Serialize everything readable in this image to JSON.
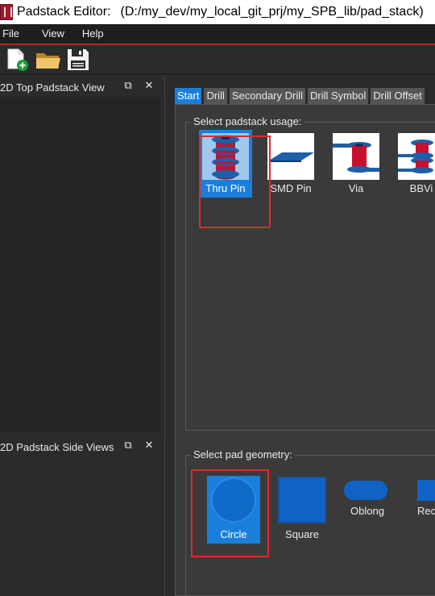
{
  "window": {
    "app_title": "Padstack Editor:",
    "file_path": "(D:/my_dev/my_local_git_prj/my_SPB_lib/pad_stack)"
  },
  "menu": {
    "items": [
      "File",
      "View",
      "Help"
    ]
  },
  "toolbar": {
    "new_icon": "new-file-icon",
    "open_icon": "open-folder-icon",
    "save_icon": "save-disk-icon"
  },
  "top_view_panel": {
    "title": "2D Top Padstack View",
    "float_icon": "⧉",
    "close_icon": "✕"
  },
  "side_view_panel": {
    "title": "2D Padstack Side Views",
    "float_icon": "⧉",
    "close_icon": "✕"
  },
  "tabs": [
    "Start",
    "Drill",
    "Secondary Drill",
    "Drill Symbol",
    "Drill Offset"
  ],
  "active_tab": "Start",
  "usage_group": {
    "title": "Select padstack usage:",
    "items": [
      "Thru Pin",
      "SMD Pin",
      "Via",
      "BBVi"
    ],
    "selected": "Thru Pin"
  },
  "geometry_group": {
    "title": "Select pad geometry:",
    "items": [
      "Circle",
      "Square",
      "Oblong",
      "Rectan"
    ],
    "selected": "Circle"
  },
  "colors": {
    "accent": "#1a7fdb",
    "highlight": "#e02a2a",
    "pad_red": "#c8102e",
    "pad_blue": "#1f5fa8"
  }
}
